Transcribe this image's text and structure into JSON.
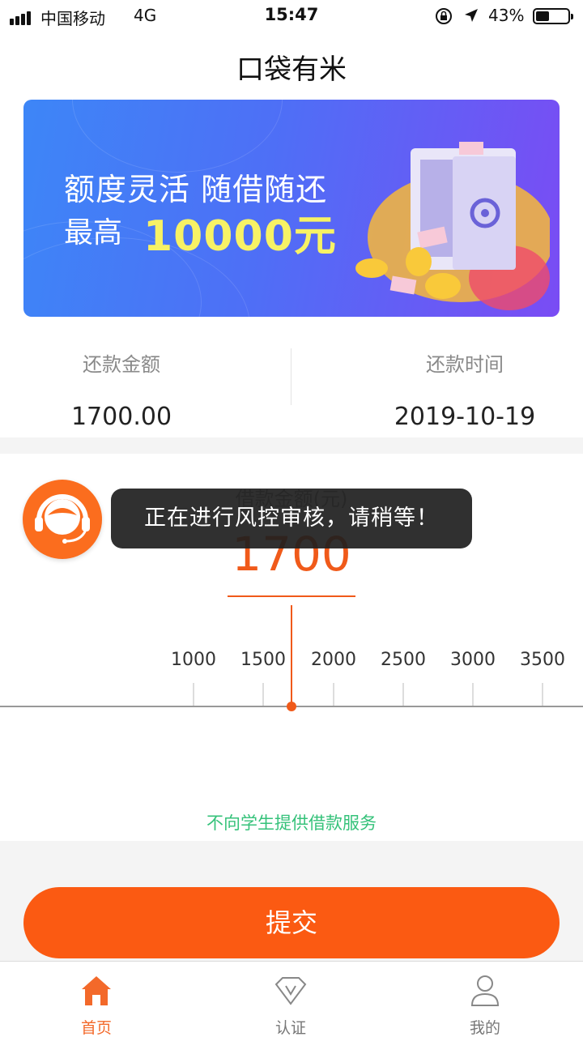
{
  "status_bar": {
    "carrier": "中国移动",
    "network": "4G",
    "time": "15:47",
    "battery_percent": "43%",
    "battery_level": 0.43,
    "icons": [
      "signal-icon",
      "rotation-lock-icon",
      "location-arrow-icon",
      "battery-icon"
    ]
  },
  "header": {
    "title": "口袋有米"
  },
  "banner": {
    "line1": "额度灵活 随借随还",
    "line2_prefix": "最高",
    "line2_amount": "10000元",
    "accent_color": "#f7f265"
  },
  "repayment": {
    "amount_label": "还款金额",
    "amount_value": "1700.00",
    "date_label": "还款时间",
    "date_value": "2019-10-19"
  },
  "loan": {
    "amount_label": "借款金额(元)",
    "amount_value": "1700",
    "slider_ticks": [
      "1000",
      "1500",
      "2000",
      "2500",
      "3000",
      "3500"
    ],
    "notice": "不向学生提供借款服务"
  },
  "toast": {
    "message": "正在进行风控审核，请稍等！"
  },
  "submit": {
    "label": "提交"
  },
  "tabbar": {
    "items": [
      {
        "label": "首页",
        "icon": "home-icon",
        "active": true
      },
      {
        "label": "认证",
        "icon": "diamond-v-icon",
        "active": false
      },
      {
        "label": "我的",
        "icon": "user-icon",
        "active": false
      }
    ]
  },
  "colors": {
    "accent": "#fb5a12",
    "notice": "#35c27a",
    "active_tab": "#f3692a"
  }
}
